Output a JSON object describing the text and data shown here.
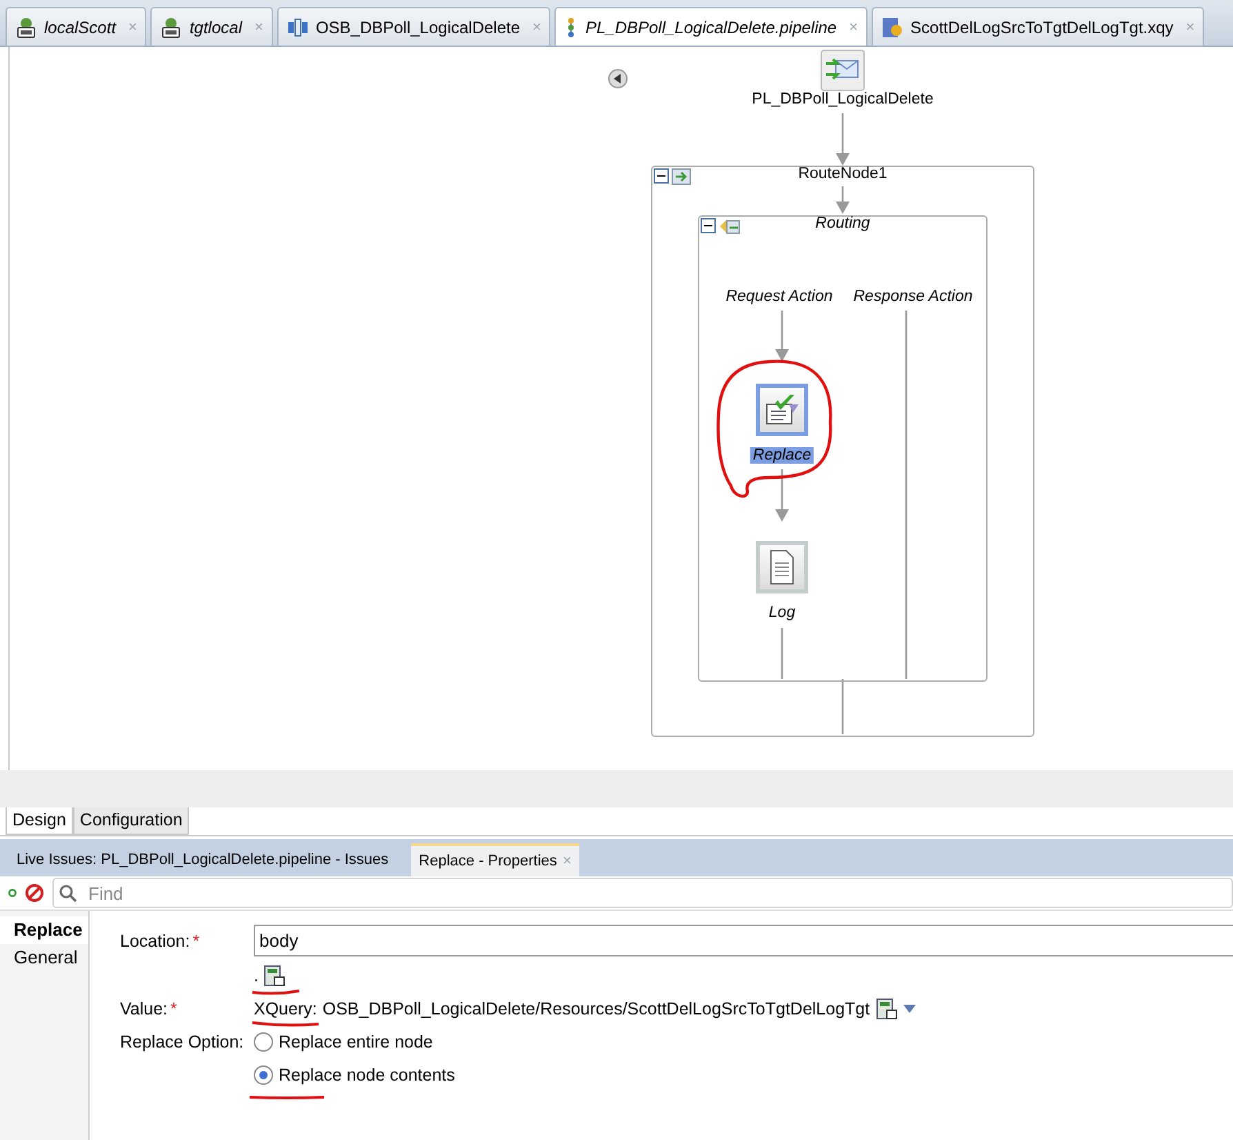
{
  "editor_tabs": [
    {
      "label": "localScott",
      "kind": "database",
      "italic": true,
      "selected": false,
      "close": "×"
    },
    {
      "label": "tgtlocal",
      "kind": "database",
      "italic": true,
      "selected": false,
      "close": "×"
    },
    {
      "label": "OSB_DBPoll_LogicalDelete",
      "kind": "service",
      "italic": false,
      "selected": false,
      "close": "×"
    },
    {
      "label": "PL_DBPoll_LogicalDelete.pipeline",
      "kind": "pipeline",
      "italic": true,
      "selected": true,
      "close": "×"
    },
    {
      "label": "ScottDelLogSrcToTgtDelLogTgt.xqy",
      "kind": "xquery",
      "italic": false,
      "selected": false,
      "close": "×"
    }
  ],
  "diagram": {
    "proxy": {
      "label": "PL_DBPoll_LogicalDelete"
    },
    "route_node": {
      "label": "RouteNode1",
      "expanded": true
    },
    "routing": {
      "label": "Routing",
      "expanded": true
    },
    "request_action": "Request Action",
    "response_action": "Response Action",
    "actions": [
      {
        "label": "Replace",
        "kind": "replace",
        "selected": true
      },
      {
        "label": "Log",
        "kind": "log",
        "selected": false
      }
    ]
  },
  "view_tabs": [
    {
      "label": "Design",
      "selected": true
    },
    {
      "label": "Configuration",
      "selected": false
    }
  ],
  "panel_tabs": [
    {
      "label": "Live Issues: PL_DBPoll_LogicalDelete.pipeline - Issues",
      "selected": false
    },
    {
      "label": "Replace - Properties",
      "selected": true,
      "close": "×"
    }
  ],
  "toolbar": {
    "search": {
      "placeholder": "Find"
    }
  },
  "side_tabs": [
    {
      "label": "Replace",
      "selected": true
    },
    {
      "label": "General",
      "selected": false
    }
  ],
  "form": {
    "location": {
      "label": "Location:",
      "required": "*",
      "value": "body"
    },
    "expression_dot": ".",
    "value": {
      "label": "Value:",
      "required": "*",
      "prefix": "XQuery:",
      "path": "OSB_DBPoll_LogicalDelete/Resources/ScottDelLogSrcToTgtDelLogTgt"
    },
    "replace_option": {
      "label": "Replace Option:",
      "options": [
        {
          "label": "Replace entire node",
          "selected": false
        },
        {
          "label": "Replace node contents",
          "selected": true
        }
      ]
    }
  }
}
